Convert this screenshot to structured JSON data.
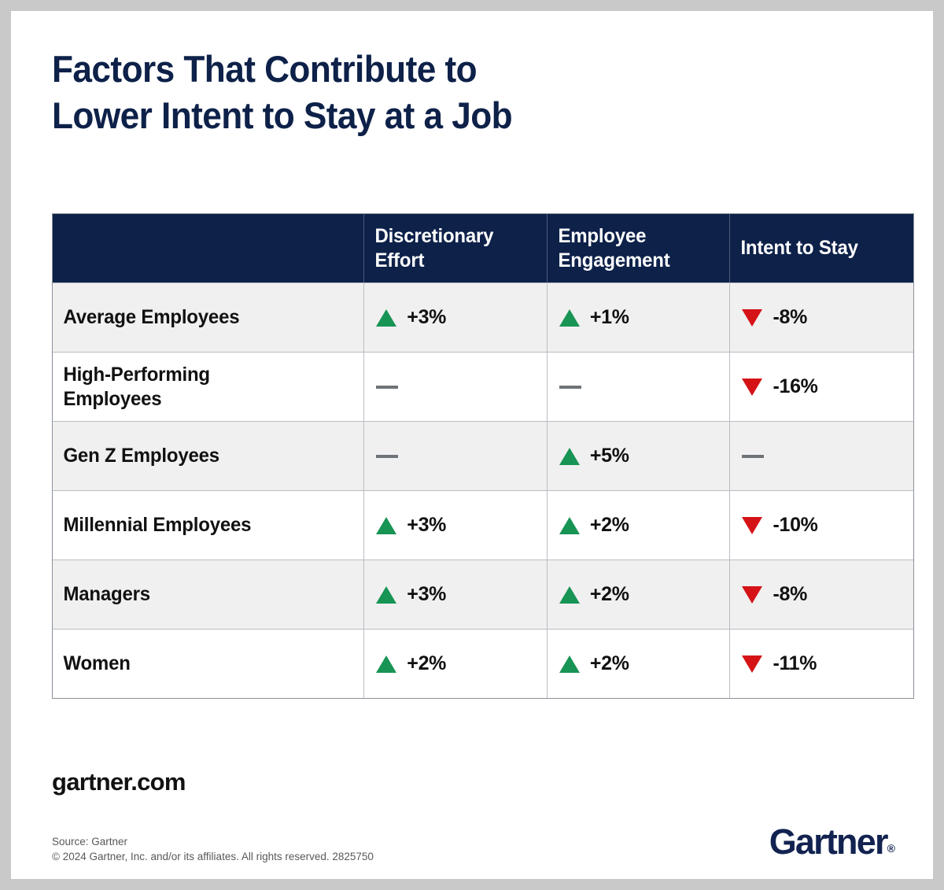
{
  "title": "Factors That Contribute to\nLower Intent to Stay at a Job",
  "table": {
    "columns": [
      {
        "key": "segment",
        "label": ""
      },
      {
        "key": "discretionary_effort",
        "label": "Discretionary\nEffort"
      },
      {
        "key": "employee_engagement",
        "label": "Employee\nEngagement"
      },
      {
        "key": "intent_to_stay",
        "label": "Intent to Stay"
      }
    ],
    "rows": [
      {
        "segment": "Average Employees",
        "cells": [
          {
            "direction": "up",
            "value": "+3%"
          },
          {
            "direction": "up",
            "value": "+1%"
          },
          {
            "direction": "down",
            "value": "-8%"
          }
        ]
      },
      {
        "segment": "High-Performing\nEmployees",
        "cells": [
          {
            "direction": "none",
            "value": ""
          },
          {
            "direction": "none",
            "value": ""
          },
          {
            "direction": "down",
            "value": "-16%"
          }
        ]
      },
      {
        "segment": "Gen Z Employees",
        "cells": [
          {
            "direction": "none",
            "value": ""
          },
          {
            "direction": "up",
            "value": "+5%"
          },
          {
            "direction": "none",
            "value": ""
          }
        ]
      },
      {
        "segment": "Millennial Employees",
        "cells": [
          {
            "direction": "up",
            "value": "+3%"
          },
          {
            "direction": "up",
            "value": "+2%"
          },
          {
            "direction": "down",
            "value": "-10%"
          }
        ]
      },
      {
        "segment": "Managers",
        "cells": [
          {
            "direction": "up",
            "value": "+3%"
          },
          {
            "direction": "up",
            "value": "+2%"
          },
          {
            "direction": "down",
            "value": "-8%"
          }
        ]
      },
      {
        "segment": "Women",
        "cells": [
          {
            "direction": "up",
            "value": "+2%"
          },
          {
            "direction": "up",
            "value": "+2%"
          },
          {
            "direction": "down",
            "value": "-11%"
          }
        ]
      }
    ]
  },
  "footer": {
    "website": "gartner.com",
    "source": "Source: Gartner",
    "copyright": "© 2024 Gartner, Inc. and/or its affiliates. All rights reserved. 2825750",
    "logo_text": "Gartner",
    "logo_mark": "®"
  },
  "colors": {
    "navy": "#0d2149",
    "positive_green": "#189455",
    "negative_red": "#d51317",
    "neutral_gray": "#6e7378",
    "row_alt": "#f0f0f0",
    "page_border": "#c9c9c9"
  },
  "chart_data": {
    "type": "table",
    "title": "Factors That Contribute to Lower Intent to Stay at a Job",
    "categories": [
      "Average Employees",
      "High-Performing Employees",
      "Gen Z Employees",
      "Millennial Employees",
      "Managers",
      "Women"
    ],
    "series": [
      {
        "name": "Discretionary Effort",
        "values": [
          3,
          null,
          null,
          3,
          3,
          2
        ]
      },
      {
        "name": "Employee Engagement",
        "values": [
          1,
          null,
          5,
          2,
          2,
          2
        ]
      },
      {
        "name": "Intent to Stay",
        "values": [
          -8,
          -16,
          null,
          -10,
          -8,
          -11
        ]
      }
    ],
    "value_unit": "percent",
    "null_marker": "—",
    "legend": "position: none"
  }
}
